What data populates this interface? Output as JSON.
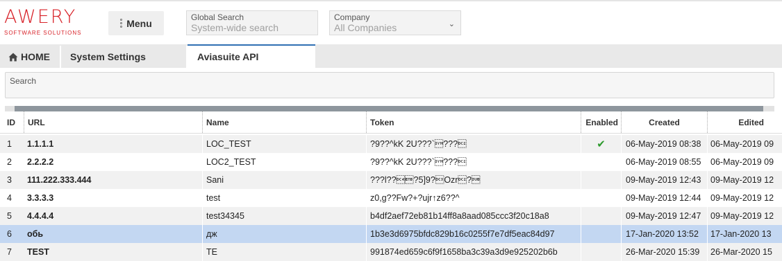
{
  "logo": {
    "main": "AWERY",
    "sub": "SOFTWARE SOLUTIONS"
  },
  "header": {
    "menu_label": "Menu",
    "global_search": {
      "label": "Global Search",
      "placeholder": "System-wide search"
    },
    "company": {
      "label": "Company",
      "value": "All Companies"
    }
  },
  "tabs": [
    {
      "label": "HOME",
      "icon": "home-icon"
    },
    {
      "label": "System Settings"
    },
    {
      "label": "Aviasuite API",
      "active": true
    }
  ],
  "search": {
    "label": "Search"
  },
  "table": {
    "columns": [
      "ID",
      "URL",
      "Name",
      "Token",
      "Enabled",
      "Created",
      "Edited"
    ],
    "rows": [
      {
        "id": "1",
        "url": "1.1.1.1",
        "name": "LOC_TEST",
        "token": "?9??^kK 2U???`\u0016???\u0012",
        "enabled": true,
        "created": "06-May-2019 08:38",
        "edited": "06-May-2019 09"
      },
      {
        "id": "2",
        "url": "2.2.2.2",
        "name": "LOC2_TEST",
        "token": "?9??^kK 2U???`\u0016???\u0012",
        "enabled": false,
        "created": "06-May-2019 08:55",
        "edited": "06-May-2019 09"
      },
      {
        "id": "3",
        "url": "111.222.333.444",
        "name": "Sani",
        "token": "???l??\u0014\u0017?5]9?\u0013Ozr\u0012?\u001a",
        "enabled": false,
        "created": "09-May-2019 12:43",
        "edited": "09-May-2019 12"
      },
      {
        "id": "4",
        "url": "3.3.3.3",
        "name": "test",
        "token": "z0,g??Fw?+?ujr↑z6??^",
        "enabled": false,
        "created": "09-May-2019 12:44",
        "edited": "09-May-2019 12"
      },
      {
        "id": "5",
        "url": "4.4.4.4",
        "name": "test34345",
        "token": "b4df2aef72eb81b14ff8a8aad085ccc3f20c18a8",
        "enabled": false,
        "created": "09-May-2019 12:47",
        "edited": "09-May-2019 12"
      },
      {
        "id": "6",
        "url": "обь",
        "name": "дж",
        "token": "1b3e3d6975bfdc829b16c0255f7e7df5eac84d97",
        "enabled": false,
        "created": "17-Jan-2020 13:52",
        "edited": "17-Jan-2020 13",
        "selected": true
      },
      {
        "id": "7",
        "url": "TEST",
        "name": "TE",
        "token": "991874ed659c6f9f1658ba3c39a3d9e925202b6b",
        "enabled": false,
        "created": "26-Mar-2020 15:39",
        "edited": "26-Mar-2020 15"
      }
    ],
    "check_glyph": "✔"
  },
  "colors": {
    "brand": "#d8232a",
    "selected_row": "#c3d7f2",
    "tab_accent": "#2f6fb3",
    "check": "#2d9a2d"
  }
}
